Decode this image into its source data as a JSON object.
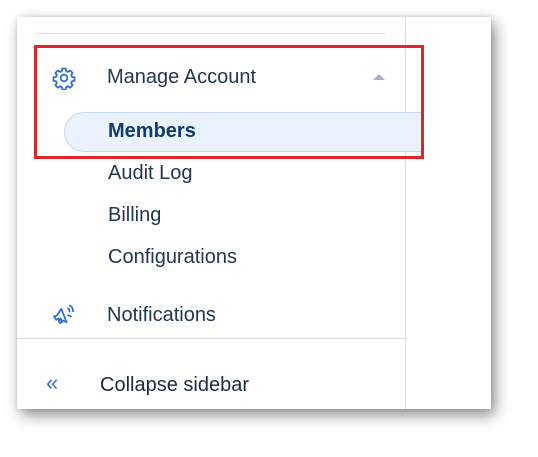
{
  "sidebar": {
    "manage_account": {
      "label": "Manage Account",
      "icon": "gear-icon",
      "expanded": true
    },
    "sub_items": [
      {
        "label": "Members",
        "active": true
      },
      {
        "label": "Audit Log",
        "active": false
      },
      {
        "label": "Billing",
        "active": false
      },
      {
        "label": "Configurations",
        "active": false
      }
    ],
    "notifications": {
      "label": "Notifications",
      "icon": "megaphone-icon"
    },
    "collapse": {
      "label": "Collapse sidebar",
      "icon": "chevrons-left-icon",
      "glyph": "«"
    }
  },
  "colors": {
    "accent": "#2f6fd0",
    "active_text": "#0f3a74",
    "active_background": "#eaf3fd",
    "text": "#23364f",
    "highlight": "#e0262b"
  }
}
